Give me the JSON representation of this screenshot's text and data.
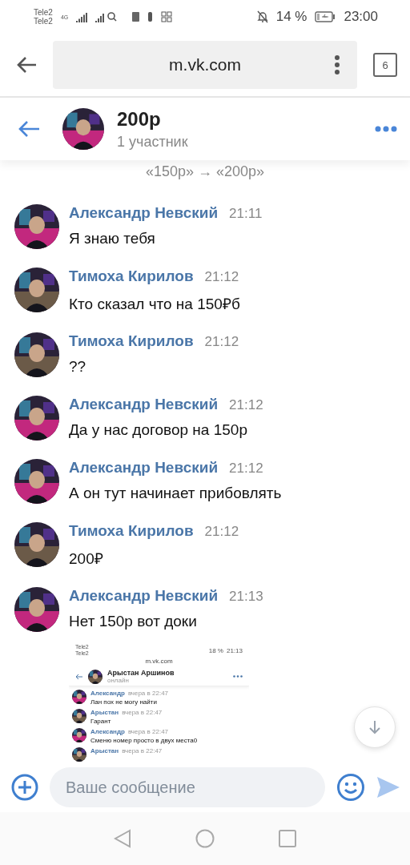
{
  "status_bar": {
    "carriers": [
      "Tele2",
      "Tele2"
    ],
    "network": "4G",
    "battery": "14 %",
    "time": "23:00"
  },
  "browser": {
    "url": "m.vk.com",
    "tab_count": "6"
  },
  "chat_header": {
    "title": "200р",
    "subtitle": "1 участник"
  },
  "service_message": "«150р» → «200р»",
  "messages": [
    {
      "author": "Александр Невский",
      "time": "21:11",
      "text": "Я знаю тебя",
      "color": "#c2287e"
    },
    {
      "author": "Тимоха Кирилов",
      "time": "21:12",
      "text": "Кто сказал что на 150₽б",
      "color": "#6b5a48"
    },
    {
      "author": "Тимоха Кирилов",
      "time": "21:12",
      "text": "??",
      "color": "#6b5a48"
    },
    {
      "author": "Александр Невский",
      "time": "21:12",
      "text": "Да у нас договор на 150р",
      "color": "#c2287e"
    },
    {
      "author": "Александр Невский",
      "time": "21:12",
      "text": "А он тут начинает прибовлять",
      "color": "#c2287e"
    },
    {
      "author": "Тимоха Кирилов",
      "time": "21:12",
      "text": "200₽",
      "color": "#6b5a48"
    },
    {
      "author": "Александр Невский",
      "time": "21:13",
      "text": "Нет 150р вот доки",
      "color": "#c2287e",
      "attachment": {
        "status_bar": {
          "carriers": [
            "Tele2",
            "Tele2"
          ],
          "battery": "18 %",
          "time": "21:13"
        },
        "url": "m.vk.com",
        "header": {
          "title": "Арыстан Аршинов",
          "subtitle": "онлайн"
        },
        "messages": [
          {
            "author": "Александр",
            "time": "вчера в 22:47",
            "text": "Лан пох не могу найти",
            "color": "#c2287e"
          },
          {
            "author": "Арыстан",
            "time": "вчера в 22:47",
            "text": "Гарант",
            "color": "#6b5a48"
          },
          {
            "author": "Александр",
            "time": "вчера в 22:47",
            "text": "Сменю номер просто в двух места0",
            "color": "#c2287e"
          },
          {
            "author": "Арыстан",
            "time": "вчера в 22:47",
            "color": "#6b5a48"
          }
        ]
      }
    }
  ],
  "composer": {
    "placeholder": "Ваше сообщение"
  }
}
